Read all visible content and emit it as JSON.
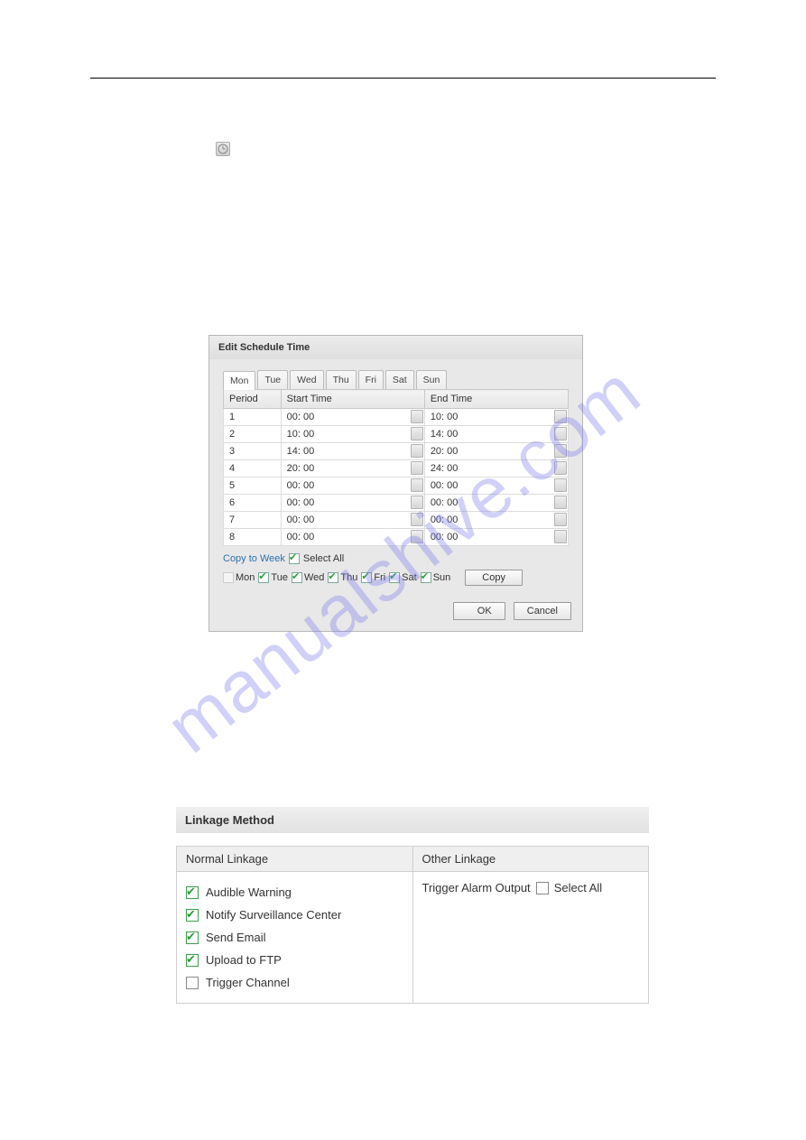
{
  "watermark": "manualshive.com",
  "schedule_dialog": {
    "title": "Edit Schedule Time",
    "tabs": [
      "Mon",
      "Tue",
      "Wed",
      "Thu",
      "Fri",
      "Sat",
      "Sun"
    ],
    "active_tab": 0,
    "columns": {
      "period": "Period",
      "start": "Start Time",
      "end": "End Time"
    },
    "rows": [
      {
        "period": "1",
        "start": "00: 00",
        "end": "10: 00"
      },
      {
        "period": "2",
        "start": "10: 00",
        "end": "14: 00"
      },
      {
        "period": "3",
        "start": "14: 00",
        "end": "20: 00"
      },
      {
        "period": "4",
        "start": "20: 00",
        "end": "24: 00"
      },
      {
        "period": "5",
        "start": "00: 00",
        "end": "00: 00"
      },
      {
        "period": "6",
        "start": "00: 00",
        "end": "00: 00"
      },
      {
        "period": "7",
        "start": "00: 00",
        "end": "00: 00"
      },
      {
        "period": "8",
        "start": "00: 00",
        "end": "00: 00"
      }
    ],
    "copy_to_week": "Copy to Week",
    "select_all": "Select All",
    "days": [
      {
        "label": "Mon",
        "checked": false,
        "disabled": true
      },
      {
        "label": "Tue",
        "checked": true
      },
      {
        "label": "Wed",
        "checked": true
      },
      {
        "label": "Thu",
        "checked": true
      },
      {
        "label": "Fri",
        "checked": true
      },
      {
        "label": "Sat",
        "checked": true
      },
      {
        "label": "Sun",
        "checked": true
      }
    ],
    "copy_btn": "Copy",
    "ok_btn": "OK",
    "cancel_btn": "Cancel"
  },
  "linkage": {
    "header": "Linkage Method",
    "normal_header": "Normal Linkage",
    "other_header": "Other Linkage",
    "normal_items": [
      {
        "label": "Audible Warning",
        "checked": true
      },
      {
        "label": "Notify Surveillance Center",
        "checked": true
      },
      {
        "label": "Send Email",
        "checked": true
      },
      {
        "label": "Upload to FTP",
        "checked": true
      },
      {
        "label": "Trigger Channel",
        "checked": false
      }
    ],
    "other_text": "Trigger Alarm Output",
    "other_select_all": "Select All",
    "other_select_all_checked": false
  }
}
